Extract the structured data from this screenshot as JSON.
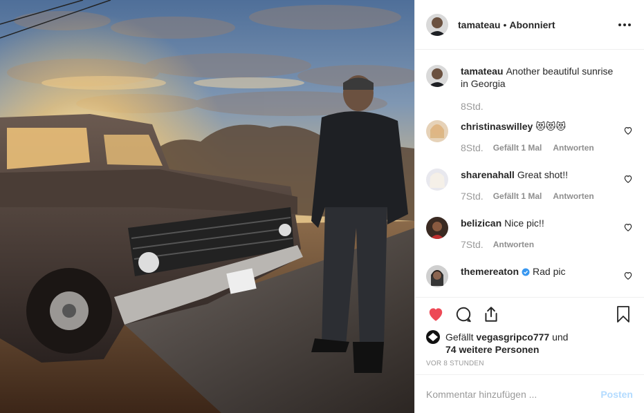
{
  "post": {
    "author": "tamateau",
    "separator": "•",
    "follow_state": "Abonniert",
    "more_icon": "more-horizontal-icon"
  },
  "comments": [
    {
      "user": "tamateau",
      "text": "Another beautiful sunrise in Georgia",
      "time": "8Std.",
      "likes": "",
      "reply": ""
    },
    {
      "user": "christinaswilley",
      "text": "😻😻😻",
      "time": "8Std.",
      "likes": "Gefällt 1 Mal",
      "reply": "Antworten"
    },
    {
      "user": "sharenahall",
      "text": "Great shot!!",
      "time": "7Std.",
      "likes": "Gefällt 1 Mal",
      "reply": "Antworten"
    },
    {
      "user": "belizican",
      "text": "Nice pic!!",
      "time": "7Std.",
      "likes": "",
      "reply": "Antworten"
    },
    {
      "user": "themereaton",
      "text": "Rad pic",
      "time": "",
      "likes": "",
      "reply": "",
      "verified": true
    }
  ],
  "likes": {
    "prefix": "Gefällt",
    "user": "vegasgripco777",
    "middle": "und",
    "others": "74 weitere Personen"
  },
  "timestamp": "VOR 8 STUNDEN",
  "add_comment": {
    "placeholder": "Kommentar hinzufügen ...",
    "post_label": "Posten"
  },
  "colors": {
    "like_red": "#ed4956",
    "verified_blue": "#3897f0",
    "post_disabled": "#b3dbff"
  }
}
